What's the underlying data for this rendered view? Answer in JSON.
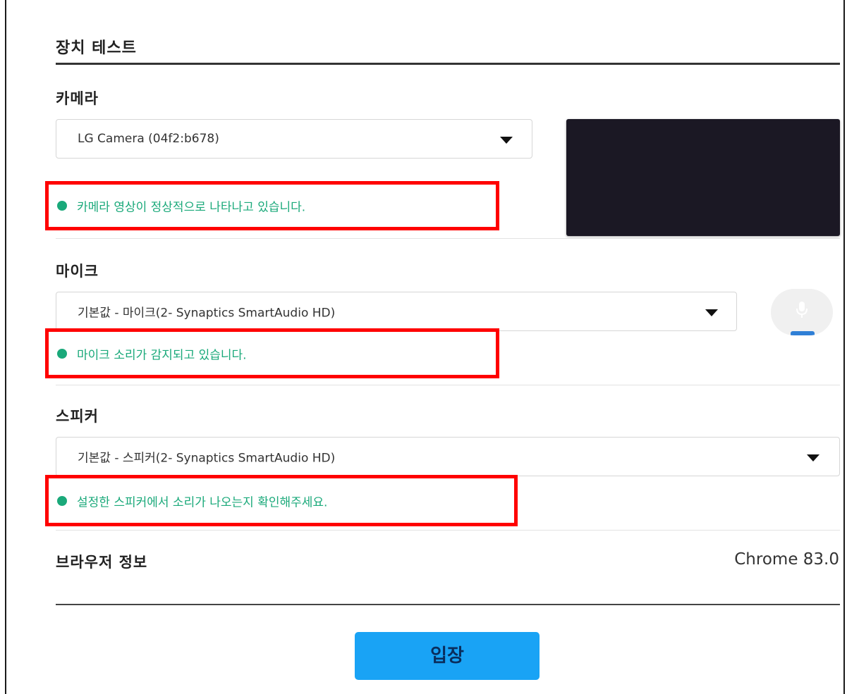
{
  "page": {
    "title": "장치 테스트"
  },
  "camera": {
    "label": "카메라",
    "selected": "LG Camera (04f2:b678)",
    "status": "카메라 영상이 정상적으로 나타나고 있습니다."
  },
  "microphone": {
    "label": "마이크",
    "selected": "기본값 - 마이크(2- Synaptics SmartAudio HD)",
    "status": "마이크 소리가 감지되고 있습니다."
  },
  "speaker": {
    "label": "스피커",
    "selected": "기본값 - 스피커(2- Synaptics SmartAudio HD)",
    "status": "설정한 스피커에서 소리가 나오는지 확인해주세요."
  },
  "browser": {
    "label": "브라우저 정보",
    "value": "Chrome 83.0"
  },
  "actions": {
    "enter_label": "입장"
  },
  "colors": {
    "status_ok": "#1aa97a",
    "highlight_box": "#ff0000",
    "button": "#19a3f5",
    "preview_bg": "#1b1824"
  },
  "icons": {
    "dropdown": "caret-down-icon",
    "mic": "microphone-icon",
    "status": "status-dot-icon"
  }
}
